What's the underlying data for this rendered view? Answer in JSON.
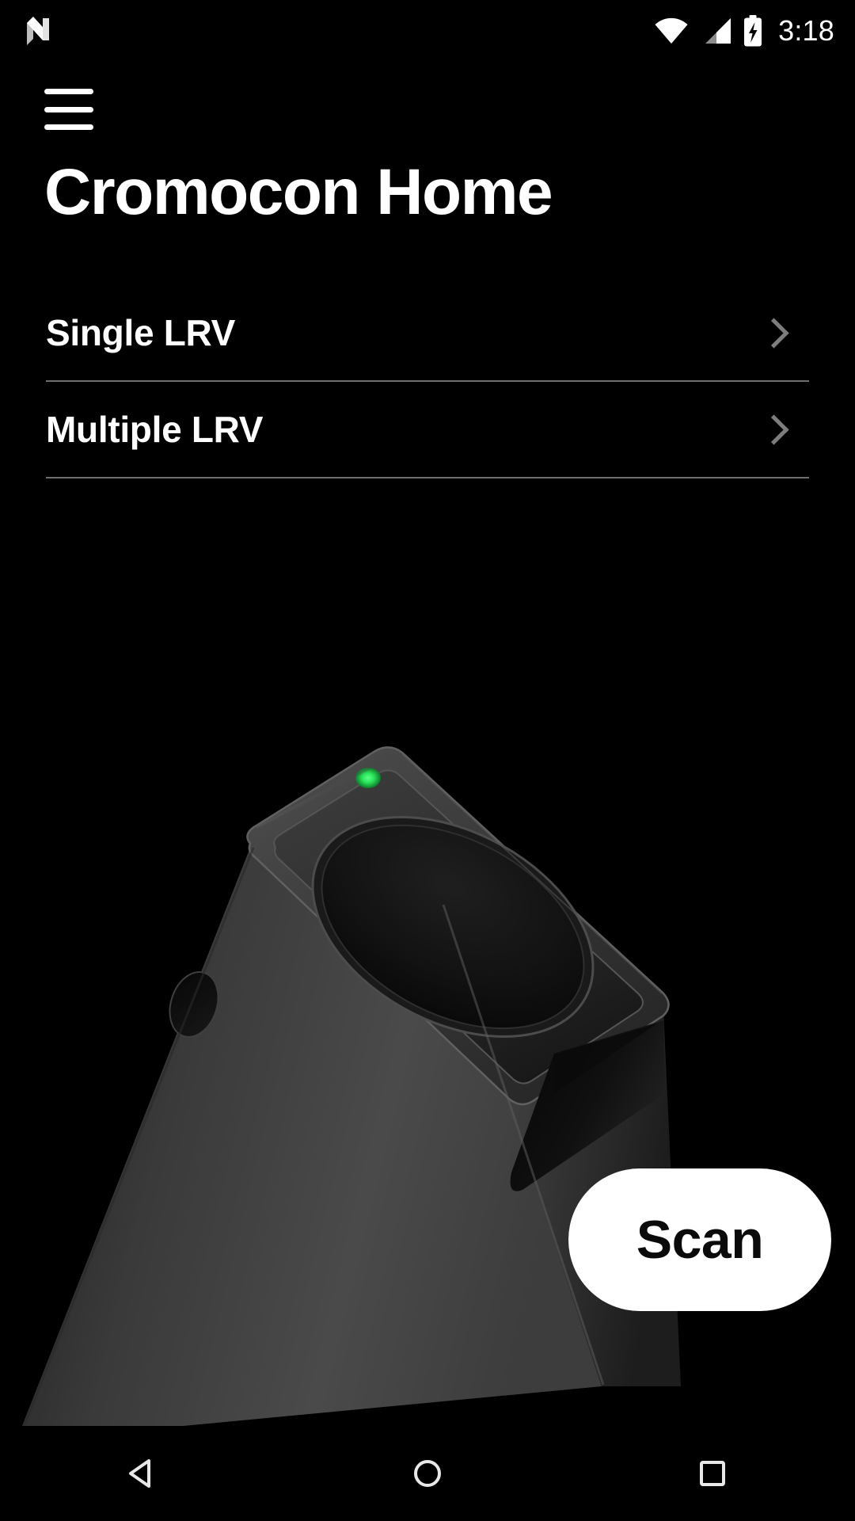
{
  "status_bar": {
    "os_logo": "android-n-logo",
    "wifi_icon": "wifi-icon",
    "signal_icon": "cell-signal-icon",
    "battery_icon": "battery-charging-icon",
    "time": "3:18"
  },
  "app_bar": {
    "menu_icon": "hamburger-menu-icon",
    "title": "Cromocon Home"
  },
  "nav_list": {
    "items": [
      {
        "label": "Single LRV",
        "chevron": "chevron-right-icon"
      },
      {
        "label": "Multiple LRV",
        "chevron": "chevron-right-icon"
      }
    ]
  },
  "device": {
    "name": "cromocon-lrv-scanner-device",
    "led_color": "#2ce65a",
    "body_color": "#2e2e2e"
  },
  "scan_button": {
    "label": "Scan",
    "background": "#ffffff",
    "text_color": "#0a0a0a"
  },
  "nav_bar": {
    "back": "back-triangle-icon",
    "home": "home-circle-icon",
    "recents": "recents-square-icon"
  },
  "theme": {
    "background": "#000000",
    "text": "#ffffff",
    "divider": "#6e6e6e",
    "chevron": "#7d7d7d"
  }
}
